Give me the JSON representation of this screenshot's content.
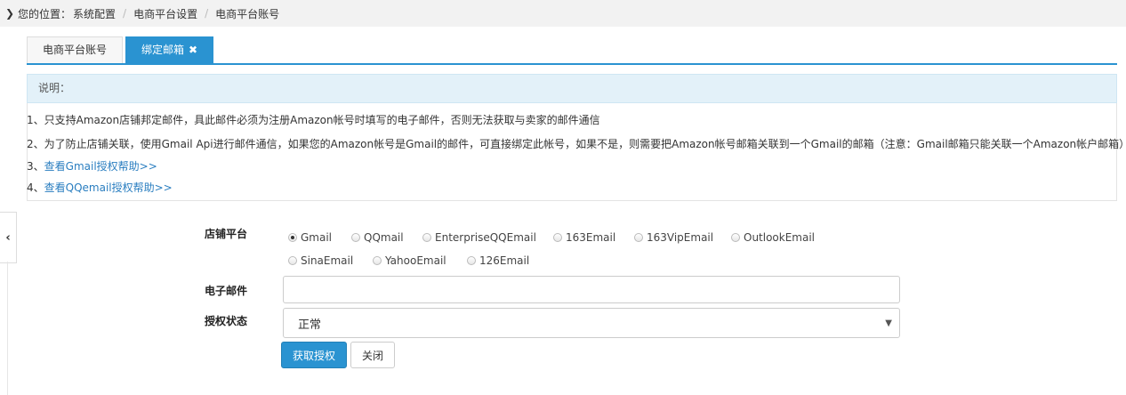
{
  "breadcrumb": {
    "icon": "chevron-right-icon",
    "prefix": "您的位置：",
    "items": [
      "系统配置",
      "电商平台设置",
      "电商平台账号"
    ]
  },
  "tabs": [
    {
      "label": "电商平台账号",
      "active": false
    },
    {
      "label": "绑定邮箱",
      "active": true,
      "close_icon": "close-icon"
    }
  ],
  "notes": {
    "title": "说明：",
    "lines": [
      {
        "text": "1、只支持Amazon店铺邦定邮件，具此邮件必须为注册Amazon帐号时填写的电子邮件，否则无法获取与卖家的邮件通信"
      },
      {
        "text": "2、为了防止店铺关联，使用Gmail Api进行邮件通信，如果您的Amazon帐号是Gmail的邮件，可直接绑定此帐号，如果不是，则需要把Amazon帐号邮箱关联到一个Gmail的邮箱（注意：Gmail邮箱只能关联一个Amazon帐户邮箱）"
      },
      {
        "prefix": "3、",
        "link": "查看Gmail授权帮助>>"
      },
      {
        "prefix": "4、",
        "link": "查看QQemail授权帮助>>"
      }
    ]
  },
  "form": {
    "platform_label": "店铺平台",
    "platforms": [
      "Gmail",
      "QQmail",
      "EnterpriseQQEmail",
      "163Email",
      "163VipEmail",
      "OutlookEmail",
      "SinaEmail",
      "YahooEmail",
      "126Email"
    ],
    "selected_platform": "Gmail",
    "email_label": "电子邮件",
    "email_value": "",
    "auth_label": "授权状态",
    "auth_value": "正常",
    "submit_label": "获取授权",
    "close_label": "关闭"
  },
  "side_toggle_icon": "chevron-left-icon",
  "colors": {
    "accent": "#2a93d1",
    "note_bg": "#e3f1f9",
    "link": "#2a7ec0"
  }
}
